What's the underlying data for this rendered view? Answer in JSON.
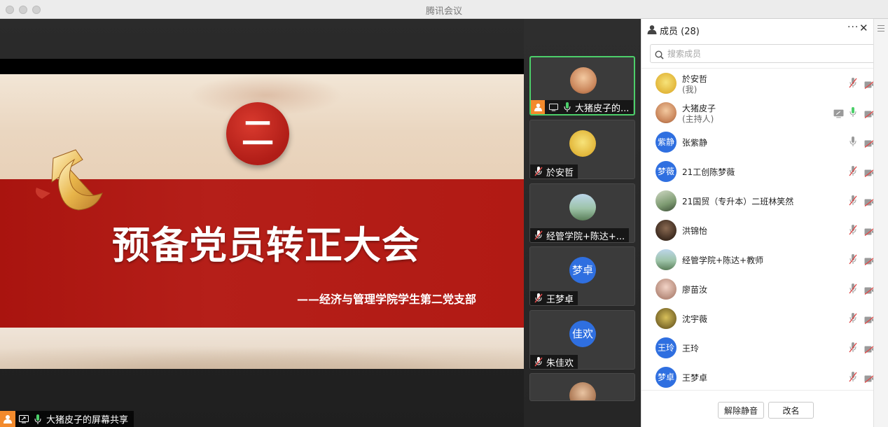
{
  "window": {
    "title": "腾讯会议"
  },
  "slide": {
    "number": "二",
    "title": "预备党员转正大会",
    "subtitle": "——经济与管理学院学生第二党支部"
  },
  "share_label": "大猪皮子的屏幕共享",
  "video_tiles": [
    {
      "name": "大猪皮子的...",
      "avatar": "photo",
      "active": true
    },
    {
      "name": "於安哲",
      "avatar": "duck"
    },
    {
      "name": "经管学院+陈达+...",
      "avatar": "photo-outdoor"
    },
    {
      "name": "王梦卓",
      "avatar_text": "梦卓"
    },
    {
      "name": "朱佳欢",
      "avatar_text": "佳欢"
    }
  ],
  "panel": {
    "title": "成员 (28)",
    "search_placeholder": "搜索成员",
    "more_icon": "more-icon",
    "close_icon": "close-icon"
  },
  "members": [
    {
      "name": "於安哲",
      "role": "(我)",
      "avatar": "duck",
      "mic": "muted",
      "camera": "off"
    },
    {
      "name": "大猪皮子",
      "role": "(主持人)",
      "avatar": "photo",
      "mic": "on",
      "camera": "off",
      "screen_share": true
    },
    {
      "name": "张紫静",
      "avatar_text": "紫静",
      "mic": "idle",
      "camera": "off"
    },
    {
      "name": "21工创陈梦薇",
      "avatar_text": "梦薇",
      "mic": "muted",
      "camera": "off"
    },
    {
      "name": "21国贸（专升本）二班林笑然",
      "avatar": "photo",
      "mic": "muted",
      "camera": "off"
    },
    {
      "name": "洪锦怡",
      "avatar": "photo",
      "mic": "muted",
      "camera": "off"
    },
    {
      "name": "经管学院+陈达+教师",
      "avatar": "photo",
      "mic": "muted",
      "camera": "off"
    },
    {
      "name": "廖苗汝",
      "avatar": "photo",
      "mic": "muted",
      "camera": "off"
    },
    {
      "name": "沈宇薇",
      "avatar": "photo",
      "mic": "muted",
      "camera": "off"
    },
    {
      "name": "王玲",
      "avatar_text": "王玲",
      "mic": "muted",
      "camera": "off"
    },
    {
      "name": "王梦卓",
      "avatar_text": "梦卓",
      "mic": "muted",
      "camera": "off"
    }
  ],
  "footer": {
    "unmute_all": "解除静音",
    "rename": "改名"
  },
  "colors": {
    "accent_blue": "#2f6fe0",
    "active_border": "#4ccf6a",
    "mic_on": "#4ccf6a",
    "slide_red": "#b11a14",
    "share_orange": "#f38a2c"
  }
}
